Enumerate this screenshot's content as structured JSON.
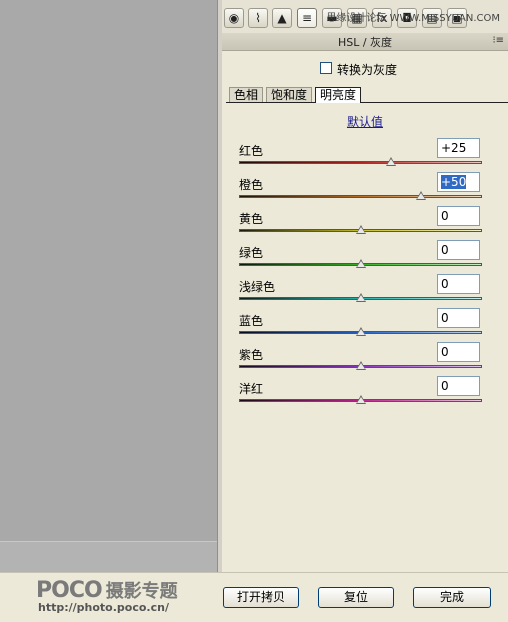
{
  "toolbar": {
    "tools": [
      {
        "name": "basic-icon",
        "glyph": "◉"
      },
      {
        "name": "tone-curve-icon",
        "glyph": "⌇"
      },
      {
        "name": "detail-icon",
        "glyph": "▲"
      },
      {
        "name": "hsl-icon",
        "glyph": "≡"
      },
      {
        "name": "split-toning-icon",
        "glyph": "▬"
      },
      {
        "name": "lens-icon",
        "glyph": "▦"
      },
      {
        "name": "fx-icon",
        "glyph": "fx"
      },
      {
        "name": "camera-calibration-icon",
        "glyph": "◘"
      },
      {
        "name": "presets-icon",
        "glyph": "▤"
      },
      {
        "name": "snapshots-icon",
        "glyph": "▣"
      }
    ],
    "watermark": "思缘设计论坛 WWW.MISSYUAN.COM"
  },
  "section": {
    "title": "HSL / 灰度",
    "menu_icon": "⁝≡"
  },
  "convert_grayscale": {
    "label": "转换为灰度",
    "checked": false
  },
  "tabs": [
    {
      "label": "色相",
      "active": false
    },
    {
      "label": "饱和度",
      "active": false
    },
    {
      "label": "明亮度",
      "active": true
    }
  ],
  "default_link": "默认值",
  "sliders": [
    {
      "label": "红色",
      "value": "+25",
      "numeric": 25,
      "selected": false,
      "gradient": [
        "#1A0A0A",
        "#B42020",
        "#F0C8C8"
      ]
    },
    {
      "label": "橙色",
      "value": "+50",
      "numeric": 50,
      "selected": true,
      "gradient": [
        "#1A120A",
        "#B46A20",
        "#F0DCC8"
      ]
    },
    {
      "label": "黄色",
      "value": "0",
      "numeric": 0,
      "selected": false,
      "gradient": [
        "#1A1A0A",
        "#C8C020",
        "#F0F0C8"
      ]
    },
    {
      "label": "绿色",
      "value": "0",
      "numeric": 0,
      "selected": false,
      "gradient": [
        "#0A1A0A",
        "#30B020",
        "#C8F0C8"
      ]
    },
    {
      "label": "浅绿色",
      "value": "0",
      "numeric": 0,
      "selected": false,
      "gradient": [
        "#0A1A1A",
        "#20B0A8",
        "#C8F0F0"
      ]
    },
    {
      "label": "蓝色",
      "value": "0",
      "numeric": 0,
      "selected": false,
      "gradient": [
        "#0A0A1A",
        "#2060C8",
        "#C8D8F0"
      ]
    },
    {
      "label": "紫色",
      "value": "0",
      "numeric": 0,
      "selected": false,
      "gradient": [
        "#140A1A",
        "#8A30C0",
        "#E0C8F0"
      ]
    },
    {
      "label": "洋红",
      "value": "0",
      "numeric": 0,
      "selected": false,
      "gradient": [
        "#1A0A14",
        "#C02090",
        "#F0C8E4"
      ]
    }
  ],
  "slider_range": [
    -100,
    100
  ],
  "buttons": {
    "open_copy": "打开拷贝",
    "reset": "复位",
    "done": "完成"
  },
  "logo": {
    "brand": "POCO",
    "tagline": "摄影专题",
    "url": "http://photo.poco.cn/"
  }
}
